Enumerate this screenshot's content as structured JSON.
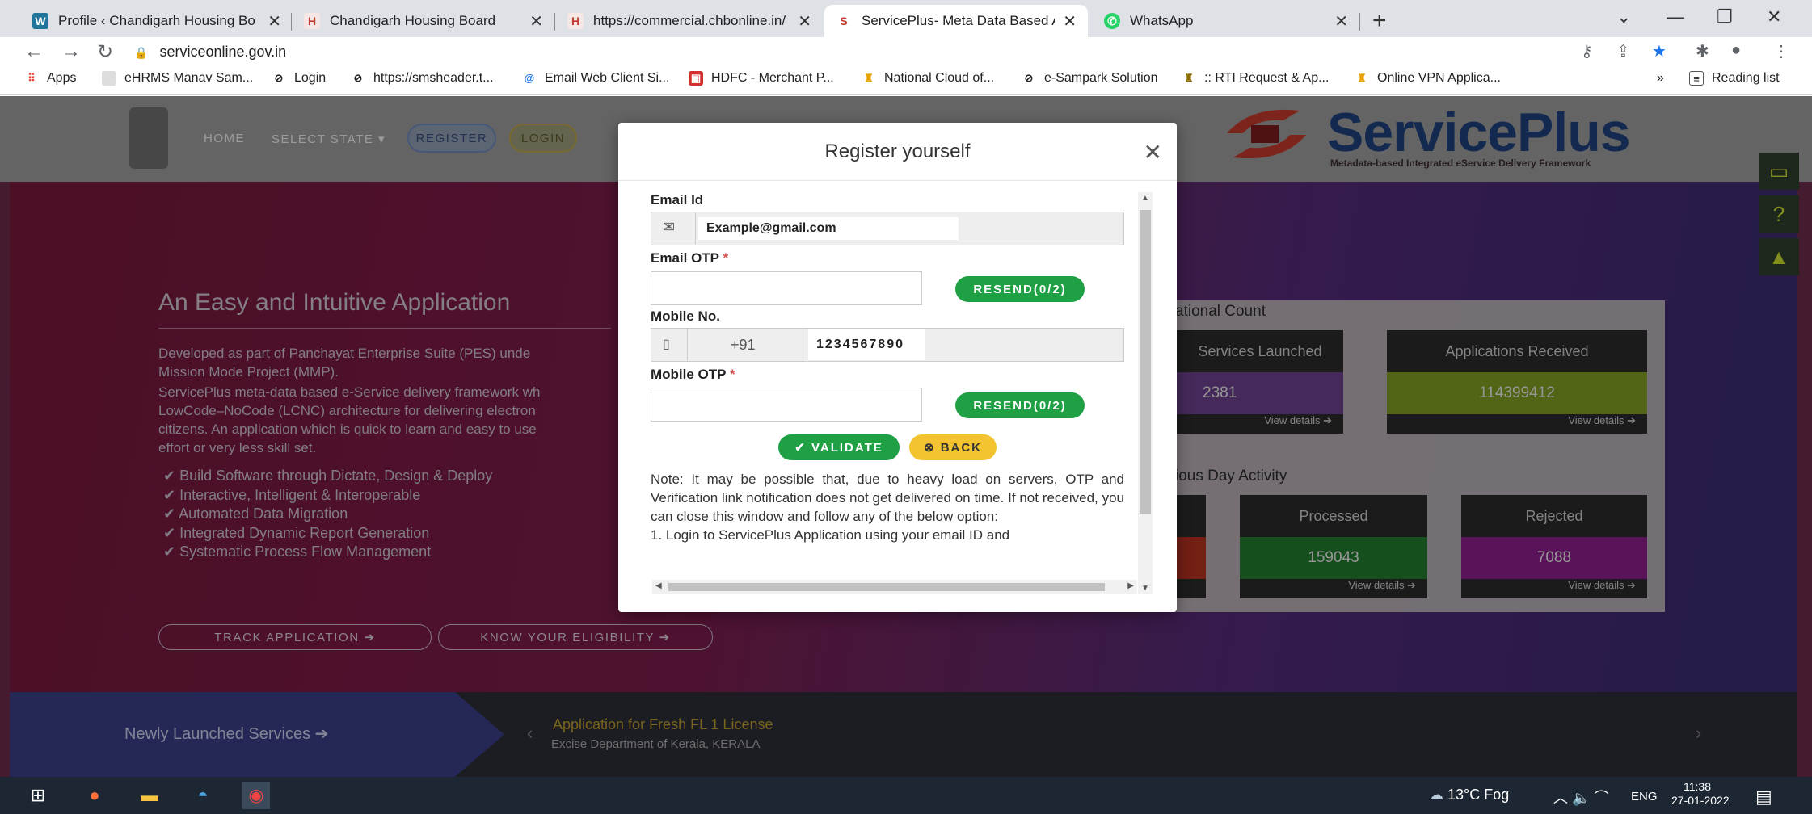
{
  "browser": {
    "tabs": [
      {
        "title": "Profile ‹ Chandigarh Housing Bo",
        "icon": "wordpress-icon"
      },
      {
        "title": "Chandigarh Housing Board",
        "icon": "chb-icon"
      },
      {
        "title": "https://commercial.chbonline.in/",
        "icon": "chb-icon"
      },
      {
        "title": "ServicePlus- Meta Data Based Ap",
        "icon": "serviceplus-icon"
      },
      {
        "title": "WhatsApp",
        "icon": "whatsapp-icon"
      }
    ],
    "url": "serviceonline.gov.in",
    "bookmarks": [
      "Apps",
      "eHRMS Manav Sam...",
      "Login",
      "https://smsheader.t...",
      "Email Web Client Si...",
      "HDFC - Merchant P...",
      "National Cloud of...",
      "e-Sampark Solution",
      ":: RTI Request & Ap...",
      "Online VPN Applica..."
    ],
    "reading_list": "Reading list"
  },
  "site": {
    "nav": {
      "home": "HOME",
      "select_state": "SELECT STATE ▾",
      "register": "REGISTER",
      "login": "LOGIN"
    },
    "brand": "ServicePlus",
    "brand_sub": "Metadata-based Integrated eService Delivery Framework",
    "hero": {
      "heading": "An Easy and Intuitive Application",
      "para": [
        "Developed as part of Panchayat Enterprise Suite (PES) unde",
        "Mission Mode Project (MMP).",
        "ServicePlus meta-data based e-Service delivery framework wh",
        "LowCode–NoCode (LCNC) architecture for delivering electron",
        "citizens. An application which is quick to learn and easy to use",
        "effort or very less skill set."
      ],
      "features": [
        "✔ Build Software through Dictate, Design & Deploy",
        "✔ Interactive, Intelligent & Interoperable",
        "✔ Automated Data Migration",
        "✔ Integrated Dynamic Report Generation",
        "✔ Systematic Process Flow Management"
      ],
      "track": "TRACK APPLICATION ➔",
      "eligibility": "KNOW YOUR ELIGIBILITY ➔"
    },
    "stats": {
      "national_heading": "ational Count",
      "services_label": "Services Launched",
      "services_value": "2381",
      "apps_label": "Applications Received",
      "apps_value": "114399412",
      "prev_heading": "ious Day Activity",
      "processed_label": "Processed",
      "processed_value": "159043",
      "rejected_label": "Rejected",
      "rejected_value": "7088",
      "view_details": "View details ➔"
    },
    "ticker": {
      "label": "Newly Launched Services ➔",
      "title": "Application for Fresh FL 1 License",
      "subtitle": "Excise Department of Kerala, KERALA"
    }
  },
  "modal": {
    "title": "Register yourself",
    "email_label": "Email Id",
    "email_value": "Example@gmail.com",
    "email_otp_label": "Email OTP",
    "resend_email": "RESEND(0/2)",
    "mobile_label": "Mobile No.",
    "country_code": "+91",
    "mobile_value": "1234567890",
    "mobile_otp_label": "Mobile OTP",
    "resend_mobile": "RESEND(0/2)",
    "validate": "✔ VALIDATE",
    "back": "⊗ BACK",
    "note": "Note: It may be possible that, due to heavy load on servers, OTP and Verification link notification does not get delivered on time. If not received, you can close this window and follow any of the below option:",
    "note_item": "1. Login to ServicePlus Application using your email ID and"
  },
  "taskbar": {
    "weather": "13°C Fog",
    "lang": "ENG",
    "time": "11:38",
    "date": "27-01-2022"
  }
}
